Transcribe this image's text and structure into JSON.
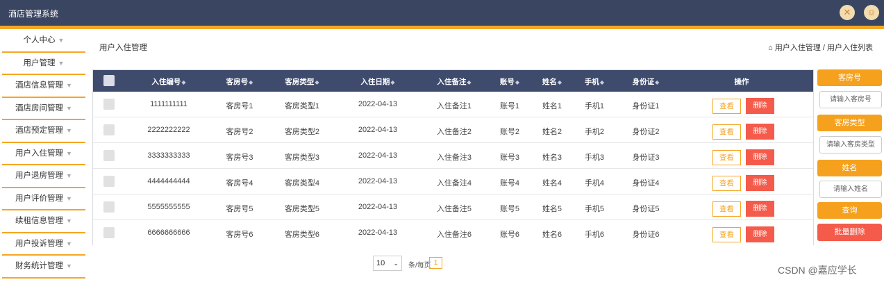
{
  "app": {
    "title": "酒店管理系统"
  },
  "header": {
    "icons": [
      "close-icon",
      "user-avatar-icon"
    ]
  },
  "sidebar": {
    "items": [
      {
        "label": "个人中心"
      },
      {
        "label": "用户管理"
      },
      {
        "label": "酒店信息管理"
      },
      {
        "label": "酒店房间管理"
      },
      {
        "label": "酒店预定管理"
      },
      {
        "label": "用户入住管理"
      },
      {
        "label": "用户退房管理"
      },
      {
        "label": "用户评价管理"
      },
      {
        "label": "续租信息管理"
      },
      {
        "label": "用户投诉管理"
      },
      {
        "label": "财务统计管理"
      }
    ]
  },
  "page": {
    "title": "用户入住管理",
    "breadcrumb": "用户入住管理 / 用户入住列表"
  },
  "table": {
    "columns": [
      "入住编号",
      "客房号",
      "客房类型",
      "入住日期",
      "入住备注",
      "账号",
      "姓名",
      "手机",
      "身份证",
      "操作"
    ],
    "rows": [
      {
        "no": "1111111111",
        "room": "客房号1",
        "type": "客房类型1",
        "date": "2022-04-13",
        "remark": "入住备注1",
        "account": "账号1",
        "name": "姓名1",
        "phone": "手机1",
        "idcard": "身份证1"
      },
      {
        "no": "2222222222",
        "room": "客房号2",
        "type": "客房类型2",
        "date": "2022-04-13",
        "remark": "入住备注2",
        "account": "账号2",
        "name": "姓名2",
        "phone": "手机2",
        "idcard": "身份证2"
      },
      {
        "no": "3333333333",
        "room": "客房号3",
        "type": "客房类型3",
        "date": "2022-04-13",
        "remark": "入住备注3",
        "account": "账号3",
        "name": "姓名3",
        "phone": "手机3",
        "idcard": "身份证3"
      },
      {
        "no": "4444444444",
        "room": "客房号4",
        "type": "客房类型4",
        "date": "2022-04-13",
        "remark": "入住备注4",
        "account": "账号4",
        "name": "姓名4",
        "phone": "手机4",
        "idcard": "身份证4"
      },
      {
        "no": "5555555555",
        "room": "客房号5",
        "type": "客房类型5",
        "date": "2022-04-13",
        "remark": "入住备注5",
        "account": "账号5",
        "name": "姓名5",
        "phone": "手机5",
        "idcard": "身份证5"
      },
      {
        "no": "6666666666",
        "room": "客房号6",
        "type": "客房类型6",
        "date": "2022-04-13",
        "remark": "入住备注6",
        "account": "账号6",
        "name": "姓名6",
        "phone": "手机6",
        "idcard": "身份证6"
      }
    ],
    "view_label": "查看",
    "delete_label": "删除"
  },
  "pager": {
    "page_size": "10",
    "label": "条/每页",
    "current_page": "1"
  },
  "search_panel": {
    "room_label": "客房号",
    "room_placeholder": "请输入客房号",
    "type_label": "客房类型",
    "type_placeholder": "请输入客房类型",
    "name_label": "姓名",
    "name_placeholder": "请输入姓名",
    "search_button": "查询",
    "batch_delete_button": "批量删除"
  },
  "watermark": "CSDN @嘉应学长",
  "colors": {
    "header_bg": "#3a4661",
    "accent": "#f5a623",
    "table_header": "#3e4b6d",
    "danger": "#f45b4b"
  }
}
